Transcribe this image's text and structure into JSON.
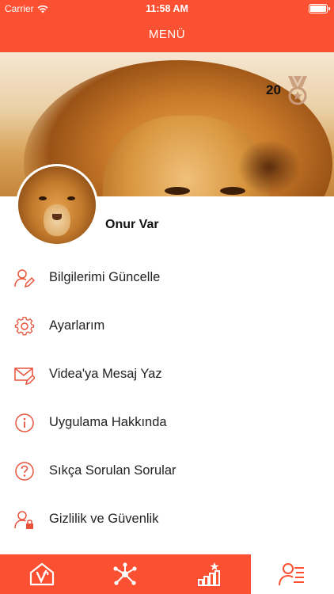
{
  "status_bar": {
    "carrier": "Carrier",
    "time": "11:58 AM"
  },
  "nav": {
    "title": "MENÜ"
  },
  "profile": {
    "score": "20",
    "name": "Onur Var"
  },
  "menu": {
    "items": [
      {
        "label": "Bilgilerimi Güncelle",
        "icon": "user-edit-icon"
      },
      {
        "label": "Ayarlarım",
        "icon": "gear-icon"
      },
      {
        "label": "Videa'ya Mesaj Yaz",
        "icon": "mail-edit-icon"
      },
      {
        "label": "Uygulama Hakkında",
        "icon": "info-icon"
      },
      {
        "label": "Sıkça Sorulan Sorular",
        "icon": "question-icon"
      },
      {
        "label": "Gizlilik ve Güvenlik",
        "icon": "user-lock-icon"
      }
    ]
  },
  "tabs": [
    {
      "icon": "home-logo-icon",
      "active": false
    },
    {
      "icon": "network-icon",
      "active": false
    },
    {
      "icon": "ranking-icon",
      "active": false
    },
    {
      "icon": "user-list-icon",
      "active": true
    }
  ],
  "colors": {
    "accent": "#fb5032",
    "icon": "#e8533a",
    "badge": "#c89a7a"
  }
}
